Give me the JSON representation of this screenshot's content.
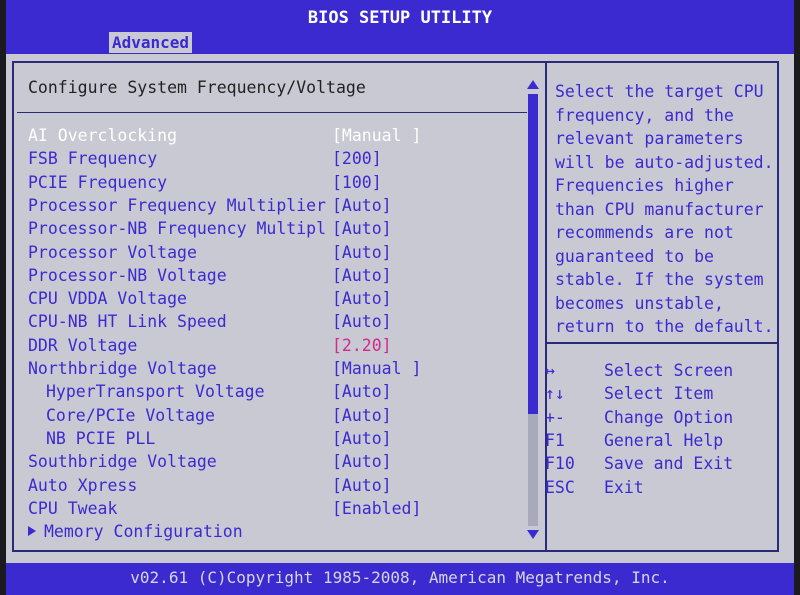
{
  "title": "BIOS SETUP UTILITY",
  "tabs": [
    {
      "label": "Advanced",
      "active": true
    }
  ],
  "section_title": "Configure System Frequency/Voltage",
  "items": [
    {
      "label": "AI Overclocking",
      "value": "[Manual ]",
      "selected": true
    },
    {
      "label": "FSB Frequency",
      "value": "[200]"
    },
    {
      "label": "PCIE Frequency",
      "value": "[100]"
    },
    {
      "label": "Processor Frequency Multiplier",
      "value": "[Auto]"
    },
    {
      "label": "Processor-NB Frequency Multipl",
      "value": "[Auto]"
    },
    {
      "label": "Processor Voltage",
      "value": "[Auto]"
    },
    {
      "label": "Processor-NB Voltage",
      "value": "[Auto]"
    },
    {
      "label": "CPU VDDA Voltage",
      "value": "[Auto]"
    },
    {
      "label": "CPU-NB HT Link Speed",
      "value": "[Auto]"
    },
    {
      "label": "DDR Voltage",
      "value": "[2.20]",
      "highlight": true
    },
    {
      "label": "Northbridge Voltage",
      "value": "[Manual ]"
    },
    {
      "label": "HyperTransport Voltage",
      "value": "[Auto]",
      "indent": true
    },
    {
      "label": "Core/PCIe Voltage",
      "value": "[Auto]",
      "indent": true
    },
    {
      "label": "NB PCIE PLL",
      "value": "[Auto]",
      "indent": true
    },
    {
      "label": "Southbridge Voltage",
      "value": "[Auto]"
    },
    {
      "label": "Auto Xpress",
      "value": "[Auto]"
    },
    {
      "label": "CPU Tweak",
      "value": "[Enabled]"
    },
    {
      "label": "Memory Configuration",
      "value": "",
      "submenu": true
    }
  ],
  "help_lines": [
    "Select the target CPU",
    "frequency, and the",
    "relevant parameters",
    "will be auto-adjusted.",
    "Frequencies higher",
    "than CPU manufacturer",
    "recommends are not",
    "guaranteed to be",
    "stable. If the system",
    "becomes unstable,",
    "return to the default."
  ],
  "keys": [
    {
      "key": "↔",
      "desc": "Select Screen"
    },
    {
      "key": "↑↓",
      "desc": "Select Item"
    },
    {
      "key": "+-",
      "desc": "Change Option"
    },
    {
      "key": "F1",
      "desc": "General Help"
    },
    {
      "key": "F10",
      "desc": "Save and Exit"
    },
    {
      "key": "ESC",
      "desc": "Exit"
    }
  ],
  "footer": "v02.61 (C)Copyright 1985-2008, American Megatrends, Inc.",
  "colors": {
    "accent": "#3b2ad0",
    "panel": "#c9c9d3",
    "highlight": "#d02a8a",
    "selected": "#ffffff"
  }
}
